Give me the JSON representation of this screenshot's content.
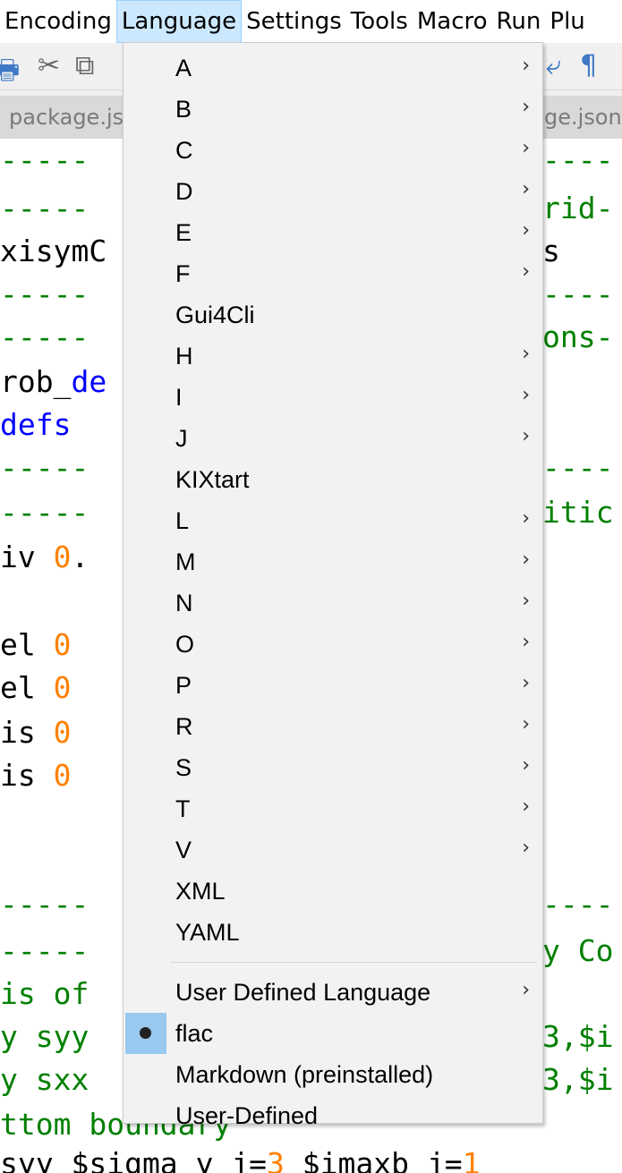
{
  "menubar": {
    "items": [
      "Encoding",
      "Language",
      "Settings",
      "Tools",
      "Macro",
      "Run",
      "Plu"
    ],
    "active": "Language"
  },
  "tabs": {
    "left": "package.js",
    "right": "ge.json"
  },
  "editor": {
    "lines": [
      {
        "text": "-----",
        "color": "green",
        "right": "----",
        "right_color": "green"
      },
      {
        "text": "-----",
        "color": "green",
        "right": "rid-",
        "right_color": "green"
      },
      {
        "text": "xisymC",
        "color": "black",
        "right": "s",
        "right_color": "black"
      },
      {
        "text": "-----",
        "color": "green",
        "right": "----",
        "right_color": "green"
      },
      {
        "text": "-----",
        "color": "green",
        "right": "ons-",
        "right_color": "green"
      },
      {
        "text": "rob_",
        "color": "black",
        "text2": "de",
        "color2": "blue"
      },
      {
        "text": "defs",
        "color": "blue",
        "text2": "",
        "color2": "black"
      },
      {
        "text": "-----",
        "color": "green",
        "right": "----",
        "right_color": "green"
      },
      {
        "text": "-----",
        "color": "green",
        "right": "itic",
        "right_color": "green"
      },
      {
        "text": "iv ",
        "color": "black",
        "text2": "0",
        "color2": "orange",
        "text3": "."
      },
      {
        "text": "",
        "color": "black"
      },
      {
        "text": "el ",
        "color": "black",
        "text2": "0",
        "color2": "orange"
      },
      {
        "text": "el ",
        "color": "black",
        "text2": "0",
        "color2": "orange"
      },
      {
        "text": "is ",
        "color": "black",
        "text2": "0",
        "color2": "orange"
      },
      {
        "text": "is ",
        "color": "black",
        "text2": "0",
        "color2": "orange"
      },
      {
        "text": "",
        "color": "black"
      },
      {
        "text": "",
        "color": "black"
      },
      {
        "text": "-----",
        "color": "green",
        "right": "----",
        "right_color": "green"
      },
      {
        "text": "-----",
        "color": "green",
        "right": "y Co",
        "right_color": "green"
      },
      {
        "text": "is of",
        "color": "green"
      },
      {
        "text": "y syy",
        "color": "green",
        "right": "3,$i",
        "right_color": "green"
      },
      {
        "text": "y sxx",
        "color": "green",
        "right": "3,$i",
        "right_color": "green"
      },
      {
        "text": "ttom boundary",
        "color": "green"
      },
      {
        "text": "syy $sigma_y j=",
        "color": "black",
        "text2": "3",
        "color2": "orange",
        "text3": " $imaxb j=",
        "text4": "1",
        "color4": "orange"
      }
    ]
  },
  "language_menu": {
    "items": [
      {
        "label": "A",
        "submenu": true
      },
      {
        "label": "B",
        "submenu": true
      },
      {
        "label": "C",
        "submenu": true
      },
      {
        "label": "D",
        "submenu": true
      },
      {
        "label": "E",
        "submenu": true
      },
      {
        "label": "F",
        "submenu": true
      },
      {
        "label": "Gui4Cli",
        "submenu": false
      },
      {
        "label": "H",
        "submenu": true
      },
      {
        "label": "I",
        "submenu": true
      },
      {
        "label": "J",
        "submenu": true
      },
      {
        "label": "KIXtart",
        "submenu": false
      },
      {
        "label": "L",
        "submenu": true
      },
      {
        "label": "M",
        "submenu": true
      },
      {
        "label": "N",
        "submenu": true
      },
      {
        "label": "O",
        "submenu": true
      },
      {
        "label": "P",
        "submenu": true
      },
      {
        "label": "R",
        "submenu": true
      },
      {
        "label": "S",
        "submenu": true
      },
      {
        "label": "T",
        "submenu": true
      },
      {
        "label": "V",
        "submenu": true
      },
      {
        "label": "XML",
        "submenu": false
      },
      {
        "label": "YAML",
        "submenu": false
      }
    ],
    "extra_items": [
      {
        "label": "User Defined Language",
        "submenu": true,
        "checked": false
      },
      {
        "label": "flac",
        "submenu": false,
        "checked": true
      },
      {
        "label": "Markdown (preinstalled)",
        "submenu": false,
        "checked": false
      },
      {
        "label": "User-Defined",
        "submenu": false,
        "checked": false
      }
    ],
    "chevron": "›"
  }
}
